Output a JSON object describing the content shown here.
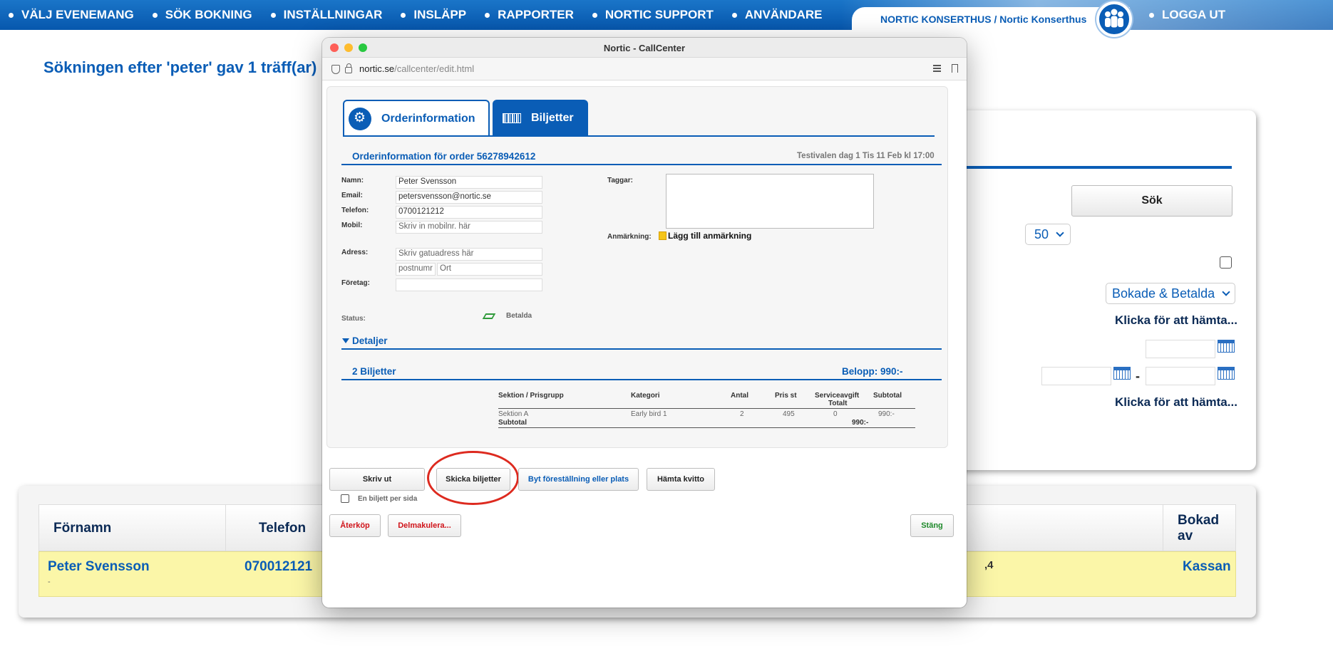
{
  "nav": {
    "items": [
      "VÄLJ EVENEMANG",
      "SÖK BOKNING",
      "INSTÄLLNINGAR",
      "INSLÄPP",
      "RAPPORTER",
      "NORTIC SUPPORT",
      "ANVÄNDARE"
    ],
    "org": "NORTIC KONSERTHUS / Nortic Konserthus",
    "logout": "LOGGA UT"
  },
  "page": {
    "search_result": "Sökningen efter 'peter' gav 1 träff(ar)"
  },
  "search_panel": {
    "search_button": "Sök",
    "count": "50",
    "status": "Bokade & Betalda",
    "fetch_label_1": "Klicka för att hämta...",
    "date_separator": "-",
    "fetch_label_2": "Klicka för att hämta..."
  },
  "results": {
    "headers": [
      "Förnamn",
      "Telefon",
      "Bokad av"
    ],
    "row": {
      "name": "Peter Svensson",
      "sub": "-",
      "phone": "070012121",
      "partial": ",4",
      "booked_by": "Kassan"
    }
  },
  "window": {
    "title": "Nortic - CallCenter",
    "url_host": "nortic.se",
    "url_path": "/callcenter/edit.html"
  },
  "tabs": {
    "orderinfo": "Orderinformation",
    "tickets": "Biljetter"
  },
  "order": {
    "title": "Orderinformation för order 56278942612",
    "event": "Testivalen dag 1 Tis 11 Feb kl 17:00",
    "labels": {
      "name": "Namn:",
      "email": "Email:",
      "phone": "Telefon:",
      "mobile": "Mobil:",
      "address": "Adress:",
      "company": "Företag:",
      "tags": "Taggar:",
      "note": "Anmärkning:",
      "status": "Status:"
    },
    "values": {
      "name": "Peter Svensson",
      "email": "petersvensson@nortic.se",
      "phone": "0700121212",
      "mobile_placeholder": "Skriv in mobilnr. här",
      "address_placeholder": "Skriv gatuadress här",
      "postcode_placeholder": "postnumr",
      "city_placeholder": "Ort",
      "company": "",
      "status": "Betalda"
    },
    "add_note": "Lägg till anmärkning",
    "details": "Detaljer"
  },
  "tickets": {
    "title": "2 Biljetter",
    "amount": "Belopp: 990:-",
    "headers": {
      "section": "Sektion / Prisgrupp",
      "category": "Kategori",
      "qty": "Antal",
      "price": "Pris st",
      "fee": "Serviceavgift",
      "fee_total": "Totalt",
      "subtotal": "Subtotal"
    },
    "row": {
      "section": "Sektion A",
      "category": "Early bird 1",
      "qty": "2",
      "price": "495",
      "fee": "0",
      "subtotal": "990:-"
    },
    "subtotal_label": "Subtotal",
    "subtotal_value": "990:-"
  },
  "actions": {
    "print": "Skriv ut",
    "send": "Skicka biljetter",
    "change": "Byt föreställning eller plats",
    "receipt": "Hämta kvitto",
    "one_per_page": "En biljett per sida",
    "refund": "Återköp",
    "partial_cancel": "Delmakulera...",
    "close": "Stäng"
  },
  "colors": {
    "brand": "#0a5db6",
    "highlight_row": "#fbf6a8",
    "refund": "#d0141a",
    "close": "#1f8a2b",
    "annotation_ring": "#dd2a1f"
  }
}
